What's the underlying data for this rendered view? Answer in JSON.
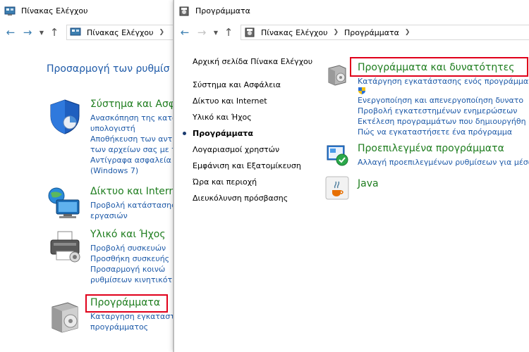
{
  "back": {
    "title": "Πίνακας Ελέγχου",
    "breadcrumb": [
      "Πίνακας Ελέγχου"
    ],
    "heading": "Προσαρμογή των ρυθμίσ",
    "categories": [
      {
        "title": "Σύστημα και Ασφ",
        "links": [
          "Ανασκόπηση της κατα",
          "υπολογιστή",
          "Αποθήκευση των αντ",
          "των αρχείων σας με τ",
          "Αντίγραφα ασφαλεία",
          "(Windows 7)"
        ]
      },
      {
        "title": "Δίκτυο και Intern",
        "links": [
          "Προβολή κατάστασης",
          "εργασιών"
        ]
      },
      {
        "title": "Υλικό και Ήχος",
        "links": [
          "Προβολή συσκευών",
          "Προσθήκη συσκευής",
          "Προσαρμογή κοινώ",
          "ρυθμίσεων κινητικότ"
        ]
      },
      {
        "title": "Προγράμματα",
        "links": [
          "Καταργηση εγκαταστα",
          "προγράμματος"
        ]
      }
    ]
  },
  "front": {
    "title": "Προγράμματα",
    "breadcrumb": [
      "Πίνακας Ελέγχου",
      "Προγράμματα"
    ],
    "nav": [
      "Αρχική σελίδα Πίνακα Ελέγχου",
      "Σύστημα και Ασφάλεια",
      "Δίκτυο και Internet",
      "Υλικό και Ήχος",
      "Προγράμματα",
      "Λογαριασμοί χρηστών",
      "Εμφάνιση και Εξατομίκευση",
      "Ώρα και περιοχή",
      "Διευκόλυνση πρόσβασης"
    ],
    "current_nav": "Προγράμματα",
    "sections": [
      {
        "title": "Προγράμματα και δυνατότητες",
        "links": [
          "Κατάργηση εγκατάστασης ενός προγράμματος",
          "Ενεργοποίηση και απενεργοποίηση δυνατο",
          "Προβολή εγκατεστημένων ενημερώσεων",
          "Εκτέλεση προγραμμάτων που δημιουργήθη",
          "Πώς να εγκαταστήσετε ένα πρόγραμμα"
        ]
      },
      {
        "title": "Προεπιλεγμένα προγράμματα",
        "links": [
          "Αλλαγή προεπιλεγμένων ρυθμίσεων για μέσα"
        ]
      },
      {
        "title": "Java",
        "links": []
      }
    ]
  },
  "colors": {
    "link": "#1e5aa8",
    "category": "#1e7d1e",
    "highlight": "#e0001a",
    "nav_arrow": "#3c7fb1"
  }
}
